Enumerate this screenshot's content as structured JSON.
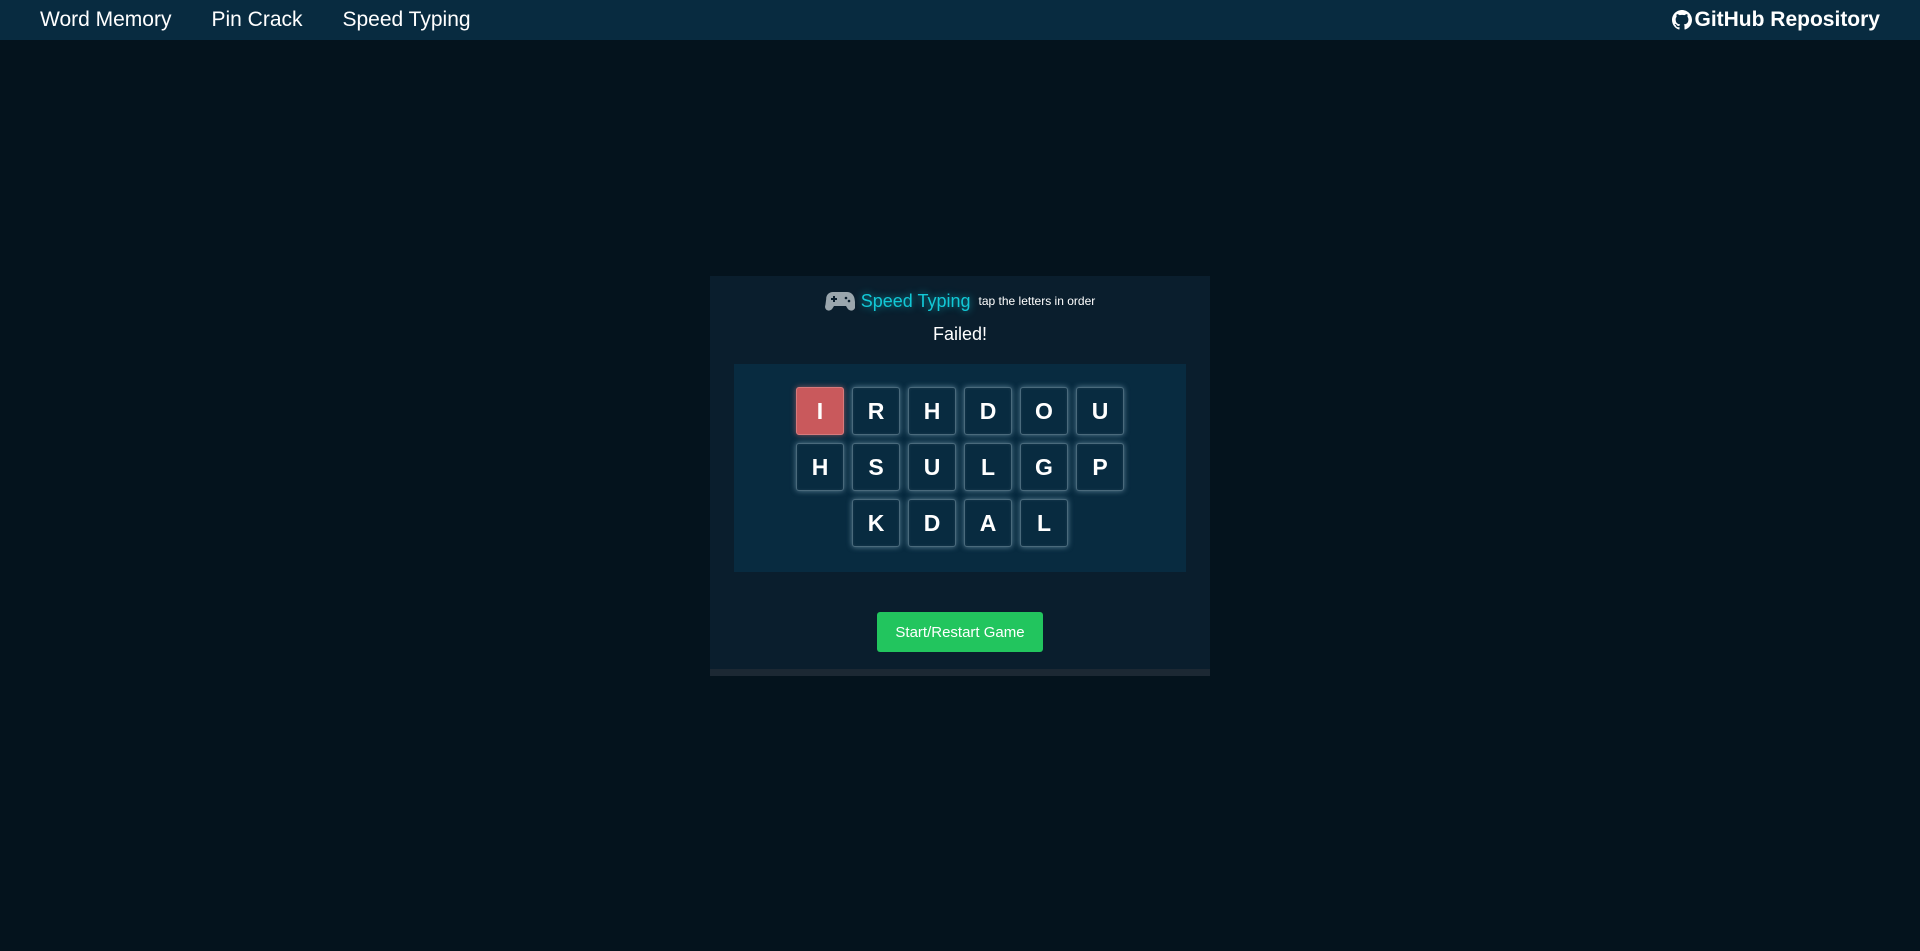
{
  "nav": {
    "links": [
      "Word Memory",
      "Pin Crack",
      "Speed Typing"
    ],
    "github_label": "GitHub Repository",
    "github_icon": "github-icon"
  },
  "game": {
    "icon": "gamepad-icon",
    "title": "Speed Typing",
    "subtitle": "tap the letters in order",
    "status": "Failed!",
    "rows": [
      [
        "I",
        "R",
        "H",
        "D",
        "O",
        "U"
      ],
      [
        "H",
        "S",
        "U",
        "L",
        "G",
        "P"
      ],
      [
        "K",
        "D",
        "A",
        "L"
      ]
    ],
    "failed_tile": "I",
    "start_button": "Start/Restart Game"
  },
  "colors": {
    "background": "#04131d",
    "nav_bg": "#082b40",
    "title_accent": "#12c8d6",
    "failed_tile": "#c9595c",
    "button": "#22c55e"
  }
}
